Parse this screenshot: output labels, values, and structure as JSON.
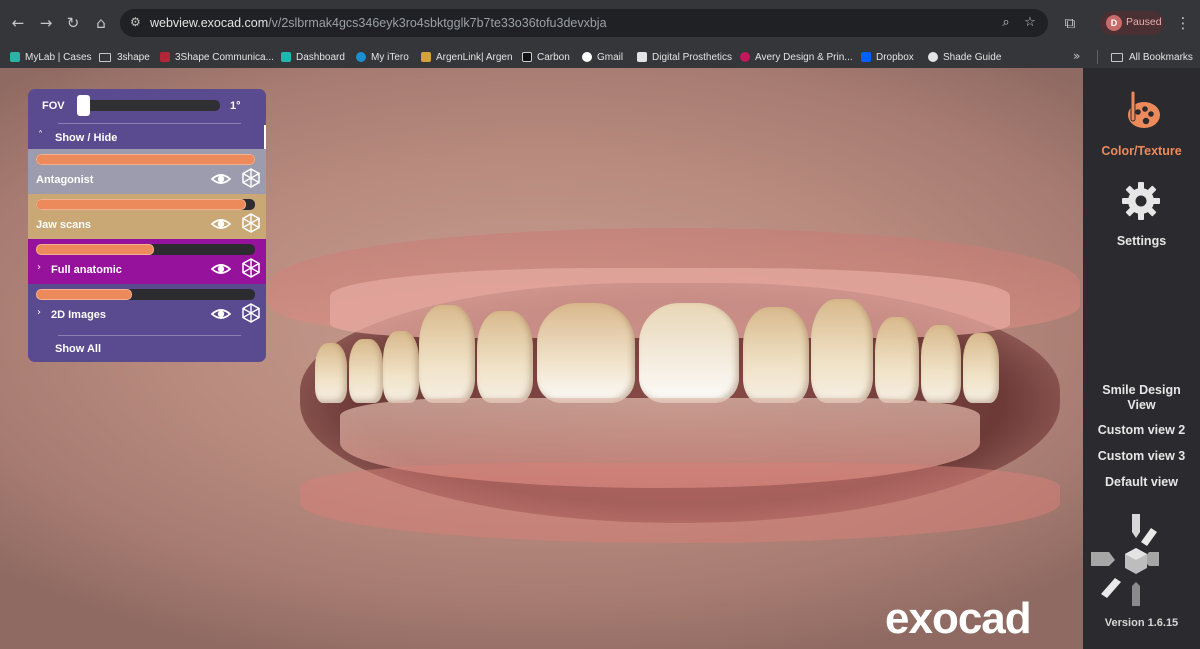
{
  "browser": {
    "nav": {
      "back_icon": "←",
      "forward_icon": "→",
      "reload_icon": "↻",
      "home_icon": "⌂"
    },
    "url": {
      "domain": "webview.exocad.com",
      "path": "/v/2slbrmak4gcs346eyk3ro4sbktgglk7b7te33o36tofu3devxbja"
    },
    "profile": {
      "initial": "D",
      "status": "Paused"
    }
  },
  "bookmarks": [
    {
      "label": "MyLab | Cases",
      "color": "#2ab3a6"
    },
    {
      "label": "3shape",
      "color": "folder"
    },
    {
      "label": "3Shape Communica...",
      "color": "#b3263a"
    },
    {
      "label": "Dashboard",
      "color": "#1fb7b0"
    },
    {
      "label": "My iTero",
      "color": "#1a8fd1"
    },
    {
      "label": "ArgenLink| Argen",
      "color": "#d4a23a"
    },
    {
      "label": "Carbon",
      "color": "#e3e3e3"
    },
    {
      "label": "Gmail",
      "color": "#ffffff"
    },
    {
      "label": "Digital Prosthetics",
      "color": "#e3e3e3"
    },
    {
      "label": "Avery Design & Prin...",
      "color": "#c2185b"
    },
    {
      "label": "Dropbox",
      "color": "#0061fe"
    },
    {
      "label": "Shade Guide",
      "color": "#e3e3e3"
    }
  ],
  "bookmarks_all": "All Bookmarks",
  "scene_panel": {
    "fov_label": "FOV",
    "fov_value": "1°",
    "fov_level": 0,
    "show_hide_label": "Show / Hide",
    "layers": [
      {
        "name": "Antagonist",
        "opacity": 1.0,
        "expandable": false
      },
      {
        "name": "Jaw scans",
        "opacity": 0.96,
        "expandable": false
      },
      {
        "name": "Full anatomic",
        "opacity": 0.54,
        "expandable": true
      },
      {
        "name": "2D Images",
        "opacity": 0.44,
        "expandable": true
      }
    ],
    "show_all_label": "Show All"
  },
  "sidebar": {
    "color_texture_label": "Color/Texture",
    "settings_label": "Settings",
    "views": [
      "Smile Design View",
      "Custom view 2",
      "Custom view 3",
      "Default view"
    ],
    "version": "Version 1.6.15"
  },
  "logo_text": "exocad",
  "colors": {
    "accent": "#ec8a5c",
    "panel": "#5a4a8f",
    "antagonist_row": "#9c9cae",
    "jaw_row": "#c9a876",
    "full_anatomic_row": "#97129c",
    "sidebar_bg": "#2b2b2f"
  },
  "icons": {
    "layer_visibility": "eye-icon",
    "layer_freeze": "snowflake-icon",
    "color_texture": "palette-brush-icon",
    "settings": "gear-icon",
    "view_cube": "view-cube-icon"
  }
}
